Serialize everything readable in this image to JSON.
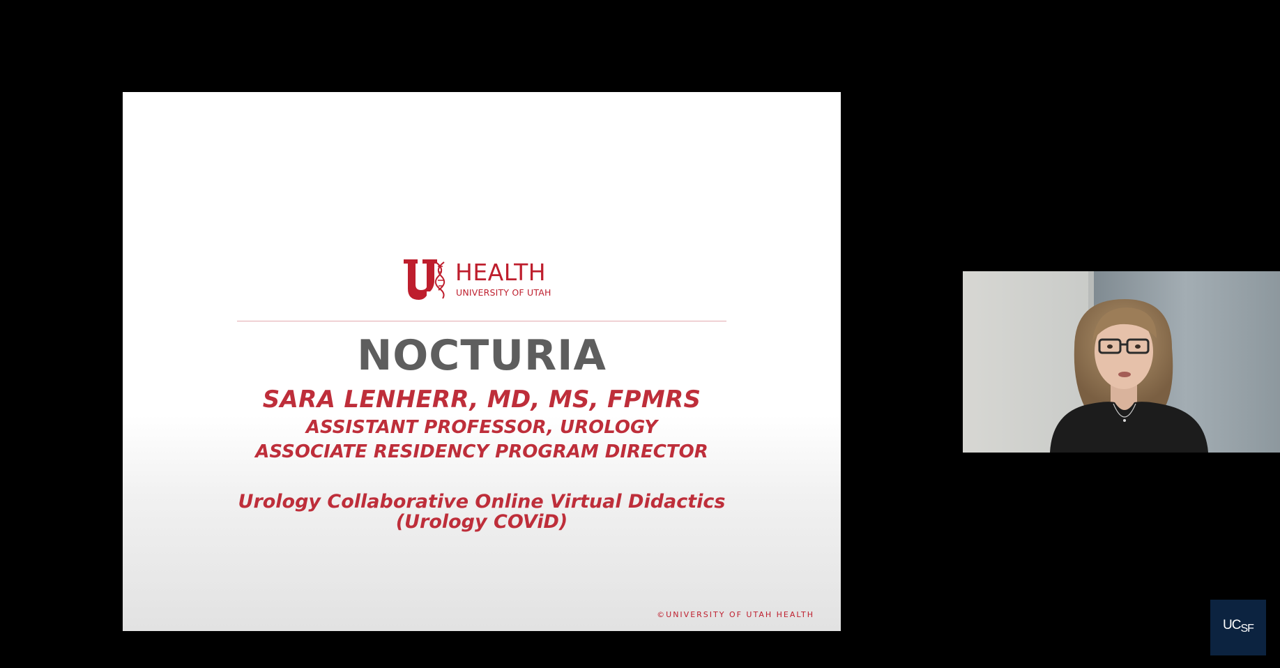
{
  "slide": {
    "logo": {
      "wordmark": "HEALTH",
      "subtitle": "UNIVERSITY OF UTAH"
    },
    "title": "NOCTURIA",
    "presenter": "SARA LENHERR, MD, MS, FPMRS",
    "roles": [
      "ASSISTANT PROFESSOR, UROLOGY",
      "ASSOCIATE RESIDENCY PROGRAM DIRECTOR"
    ],
    "program": [
      "Urology Collaborative Online Virtual Didactics",
      "(Urology COViD)"
    ],
    "copyright": "©UNIVERSITY OF UTAH HEALTH"
  },
  "badge": {
    "letters_main": "UC",
    "letters_sub": "SF"
  },
  "colors": {
    "brand_red": "#be1e2d",
    "title_gray": "#5e5e5e",
    "badge_navy": "#0c2340",
    "background": "#000000"
  }
}
